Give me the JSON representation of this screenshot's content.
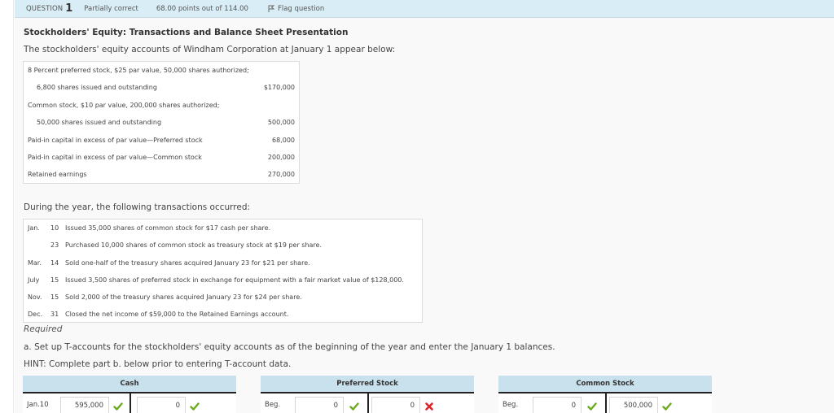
{
  "header": {
    "question_label": "QUESTION",
    "question_number": "1",
    "status": "Partially correct",
    "points": "68.00 points out of 114.00",
    "flag_label": "Flag question"
  },
  "problem": {
    "title": "Stockholders' Equity: Transactions and Balance Sheet Presentation",
    "intro": "The stockholders' equity accounts of Windham Corporation at January 1 appear below:",
    "equity_rows": [
      {
        "label": "8 Percent preferred stock, $25 par value, 50,000 shares authorized;",
        "amount": "",
        "indent": false
      },
      {
        "label": "6,800 shares issued and outstanding",
        "amount": "$170,000",
        "indent": true
      },
      {
        "label": "Common stock, $10 par value, 200,000 shares authorized;",
        "amount": "",
        "indent": false
      },
      {
        "label": "50,000 shares issued and outstanding",
        "amount": "500,000",
        "indent": true
      },
      {
        "label": "Paid-in capital in excess of par value—Preferred stock",
        "amount": "68,000",
        "indent": false
      },
      {
        "label": "Paid-in capital in excess of par value—Common stock",
        "amount": "200,000",
        "indent": false
      },
      {
        "label": "Retained earnings",
        "amount": "270,000",
        "indent": false
      }
    ],
    "during_text": "During the year, the following transactions occurred:",
    "transactions": [
      {
        "month": "Jan.",
        "day": "10",
        "description": "Issued 35,000 shares of common stock for $17 cash per share."
      },
      {
        "month": "",
        "day": "23",
        "description": "Purchased 10,000 shares of common stock as treasury stock at $19 per share."
      },
      {
        "month": "Mar.",
        "day": "14",
        "description": "Sold one-half of the treasury shares acquired January 23 for $21 per share."
      },
      {
        "month": "July",
        "day": "15",
        "description": "Issued 3,500 shares of preferred stock in exchange for equipment with a fair market value of $128,000."
      },
      {
        "month": "Nov.",
        "day": "15",
        "description": "Sold 2,000 of the treasury shares acquired January 23 for $24 per share."
      },
      {
        "month": "Dec.",
        "day": "31",
        "description": "Closed the net income of $59,000 to the Retained Earnings account."
      }
    ],
    "required_label": "Required",
    "part_a": "a. Set up T-accounts for the stockholders' equity accounts as of the beginning of the year and enter the January 1 balances.",
    "hint": "HINT: Complete part b. below prior to entering T-account data."
  },
  "taccounts": [
    {
      "title": "Cash",
      "row_label": "Jan.10",
      "debit_value": "595,000",
      "debit_status": "correct",
      "credit_value": "0",
      "credit_status": "correct"
    },
    {
      "title": "Preferred Stock",
      "row_label": "Beg.",
      "debit_value": "0",
      "debit_status": "correct",
      "credit_value": "0",
      "credit_status": "incorrect"
    },
    {
      "title": "Common Stock",
      "row_label": "Beg.",
      "debit_value": "0",
      "debit_status": "correct",
      "credit_value": "500,000",
      "credit_status": "correct"
    }
  ],
  "colors": {
    "header_bg": "#d9edf6",
    "taccount_header_bg": "#c9e1ec",
    "correct": "#6aaa1e",
    "incorrect": "#e0242b"
  }
}
